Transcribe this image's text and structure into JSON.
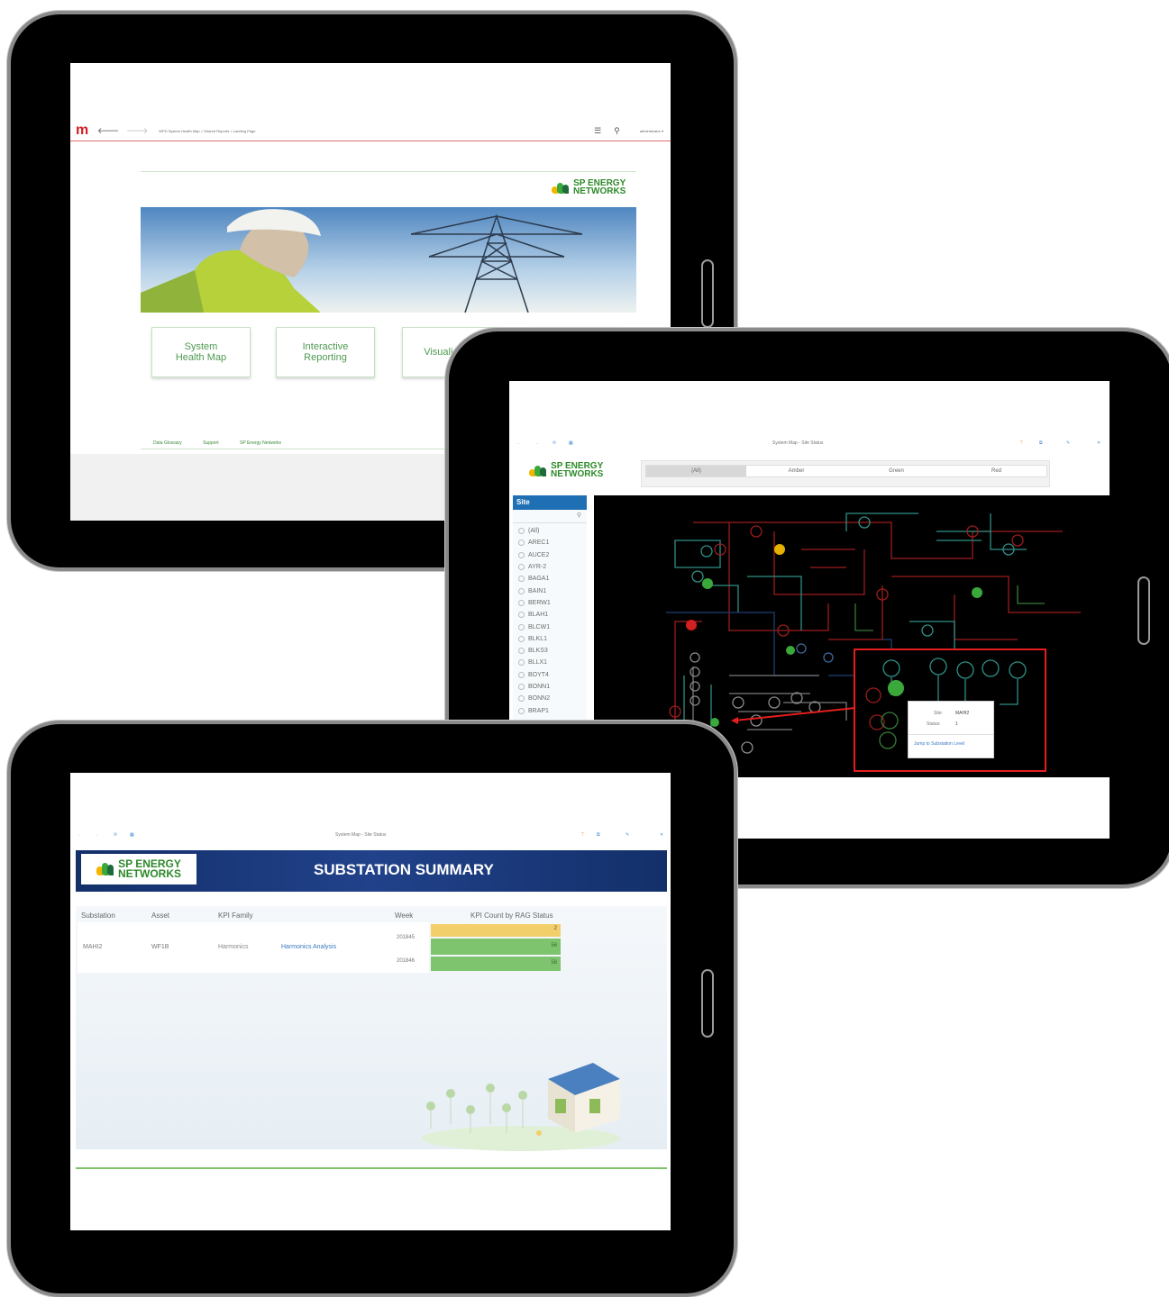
{
  "landing": {
    "breadcrumb": "WPD System Health Map > Shared Reports > Landing Page",
    "user_menu": "administrator ▾",
    "logo_line1": "SP ENERGY",
    "logo_line2": "NETWORKS",
    "tiles": [
      "System\nHealth Map",
      "Interactive\nReporting",
      "Visualisation",
      ""
    ],
    "footer_links": [
      "Data Glossary",
      "Support",
      "SP Energy Networks"
    ]
  },
  "site_status": {
    "window_title": "System Map - Site Status",
    "logo_line1": "SP ENERGY",
    "logo_line2": "NETWORKS",
    "tabs": [
      "(All)",
      "Amber",
      "Green",
      "Red"
    ],
    "site_header": "Site",
    "search_icon": "search-icon",
    "sites": [
      "(All)",
      "AREC1",
      "AUCE2",
      "AYR-2",
      "BAGA1",
      "BAIN1",
      "BERW1",
      "BLAH1",
      "BLCW1",
      "BLKL1",
      "BLKS3",
      "BLLX1",
      "BOYT4",
      "BONN1",
      "BONN2",
      "BRAP1"
    ],
    "popup": {
      "site_label": "Site:",
      "site_value": "MAHI2",
      "status_label": "Status:",
      "status_value": "1",
      "link": "Jump to Substation Level"
    },
    "colors": {
      "red": "#d21f1f",
      "green": "#3aa83a",
      "amber": "#e5b000",
      "teal": "#2f8f86"
    }
  },
  "substation_summary": {
    "window_title": "System Map - Site Status",
    "logo_line1": "SP ENERGY",
    "logo_line2": "NETWORKS",
    "banner_title": "SUBSTATION SUMMARY",
    "columns": [
      "Substation",
      "Asset",
      "KPI Family",
      "Week",
      "KPI Count by RAG Status"
    ],
    "row": {
      "substation": "MAHI2",
      "asset": "WF1B",
      "kpi_family": "Harmonics",
      "analysis_link": "Harmonics Analysis"
    },
    "weeks": [
      "201845",
      "201846"
    ],
    "rag_counts": [
      "2",
      "56",
      "58"
    ],
    "colors": {
      "amber": "#f2cf6b",
      "green": "#7ec46e",
      "navy": "#13306a"
    }
  }
}
